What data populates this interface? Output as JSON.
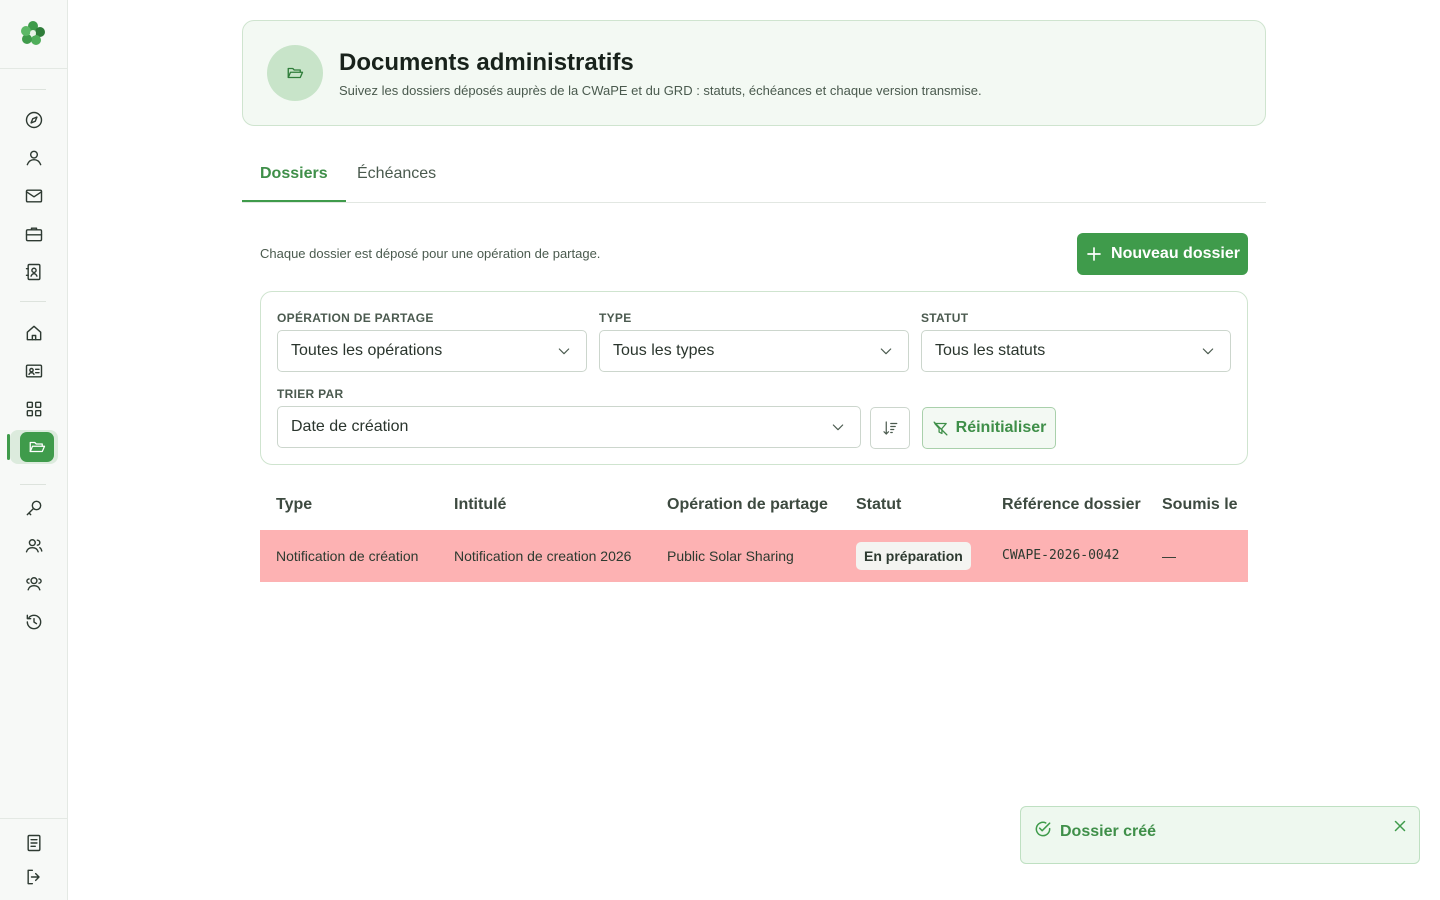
{
  "header": {
    "title": "Documents administratifs",
    "subtitle": "Suivez les dossiers déposés auprès de la CWaPE et du GRD : statuts, échéances et chaque version transmise."
  },
  "tabs": [
    {
      "label": "Dossiers",
      "active": true
    },
    {
      "label": "Échéances",
      "active": false
    }
  ],
  "intro": "Chaque dossier est déposé pour une opération de partage.",
  "new_button": "Nouveau dossier",
  "filters": {
    "operation": {
      "label": "OPÉRATION DE PARTAGE",
      "value": "Toutes les opérations"
    },
    "type": {
      "label": "TYPE",
      "value": "Tous les types"
    },
    "status": {
      "label": "STATUT",
      "value": "Tous les statuts"
    },
    "sort": {
      "label": "TRIER PAR",
      "value": "Date de création"
    },
    "reset": "Réinitialiser"
  },
  "table": {
    "columns": [
      "Type",
      "Intitulé",
      "Opération de partage",
      "Statut",
      "Référence dossier",
      "Soumis le"
    ],
    "rows": [
      {
        "type": "Notification de création",
        "title": "Notification de creation 2026",
        "operation": "Public Solar Sharing",
        "status": "En préparation",
        "reference": "CWAPE-2026-0042",
        "submitted": "—",
        "highlight_color": "#fdb2b3"
      }
    ]
  },
  "toast": {
    "message": "Dossier créé"
  },
  "sidebar": {
    "icons": [
      "compass-icon",
      "user-icon",
      "mail-icon",
      "briefcase-icon",
      "contact-card-icon",
      "home-icon",
      "id-card-icon",
      "grid-icon",
      "folder-open-icon",
      "key-icon",
      "users-icon",
      "users-group-icon",
      "history-icon",
      "document-icon",
      "logout-icon"
    ],
    "active": "folder-open-icon"
  },
  "colors": {
    "accent": "#3f9b4b",
    "row_highlight": "#fdb2b3",
    "header_bg": "#f3f9f3"
  }
}
